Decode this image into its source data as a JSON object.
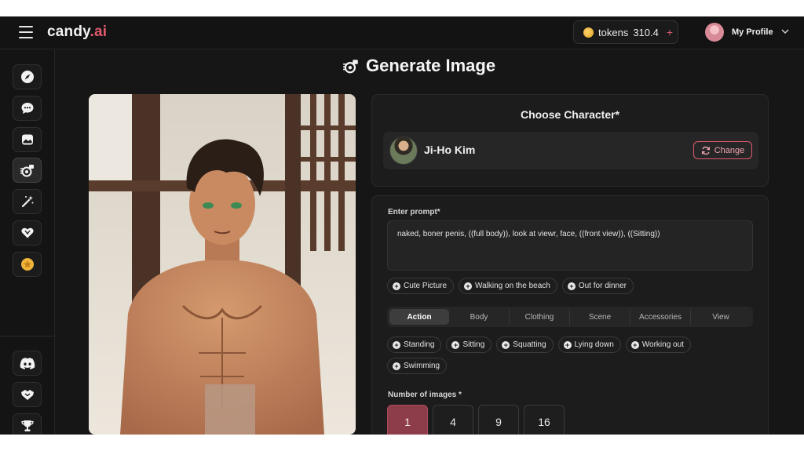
{
  "header": {
    "logo_part1": "candy",
    "logo_part2": ".ai",
    "tokens_label": "tokens",
    "tokens_value": "310.4",
    "tokens_plus": "+",
    "profile_name": "My Profile"
  },
  "sidebar": {
    "items": [
      {
        "icon": "compass-icon"
      },
      {
        "icon": "chat-icon"
      },
      {
        "icon": "gallery-icon"
      },
      {
        "icon": "generate-image-icon"
      },
      {
        "icon": "magic-wand-icon"
      },
      {
        "icon": "heart-icon"
      },
      {
        "icon": "premium-star-icon"
      }
    ],
    "bottom_items": [
      {
        "icon": "discord-icon"
      },
      {
        "icon": "affiliate-icon"
      },
      {
        "icon": "trophy-icon"
      }
    ]
  },
  "main": {
    "title": "Generate Image",
    "choose_character": {
      "heading": "Choose Character*",
      "name": "Ji-Ho Kim",
      "change_label": "Change"
    },
    "prompt": {
      "label": "Enter prompt*",
      "value": "naked, boner penis, ((full body)), look at viewr, face, ((front view)),  ((Sitting))"
    },
    "suggestions": [
      "Cute Picture",
      "Walking on the beach",
      "Out for dinner"
    ],
    "tabs": [
      "Action",
      "Body",
      "Clothing",
      "Scene",
      "Accessories",
      "View"
    ],
    "active_tab": "Action",
    "action_options": [
      "Standing",
      "Sitting",
      "Squatting",
      "Lying down",
      "Working out",
      "Swimming"
    ],
    "num_images": {
      "label": "Number of images *",
      "options": [
        "1",
        "4",
        "9",
        "16"
      ],
      "selected": "1"
    }
  },
  "colors": {
    "accent": "#e05a6e",
    "selected_number": "#8d3c49",
    "background": "#161616",
    "panel": "#1c1c1c"
  }
}
